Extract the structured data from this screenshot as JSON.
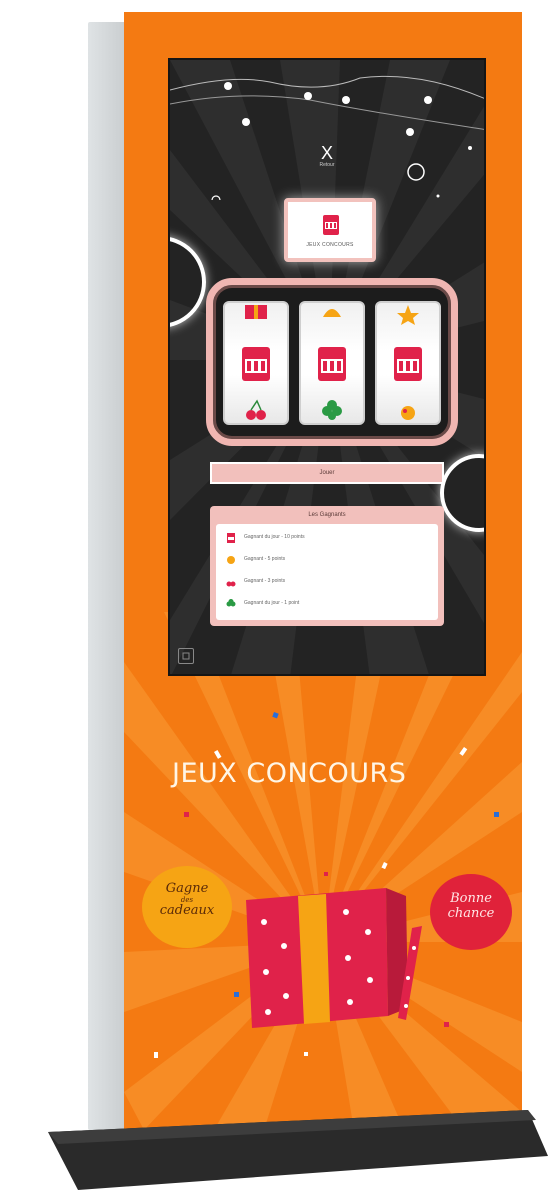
{
  "screen": {
    "close_label": "X",
    "close_caption": "Retour",
    "logo_caption": "JEUX CONCOURS",
    "spin_label": "Jouer",
    "winners_title": "Les Gagnants",
    "winners": [
      {
        "icon": "slot-sign-icon",
        "text": "Gagnant du jour - 10 points"
      },
      {
        "icon": "fruit-icon",
        "text": "Gagnant - 5 points"
      },
      {
        "icon": "cherry-icon",
        "text": "Gagnant - 3 points"
      },
      {
        "icon": "clover-icon",
        "text": "Gagnant du jour - 1 point"
      }
    ]
  },
  "reels": [
    {
      "top": "gift-symbol",
      "middle": "777-sign",
      "bottom": "cherry-symbol"
    },
    {
      "top": "bell-symbol",
      "middle": "777-sign",
      "bottom": "clover-symbol"
    },
    {
      "top": "star-symbol",
      "middle": "777-sign",
      "bottom": "fruit-symbol"
    }
  ],
  "poster": {
    "headline": "JEUX CONCOURS",
    "left_bubble": {
      "line1": "Gagne",
      "small": "des",
      "line2": "cadeaux"
    },
    "right_bubble": {
      "line1": "Bonne",
      "line2": "chance"
    }
  },
  "colors": {
    "front": "#f47a12",
    "ray_light": "#f8922c",
    "screen_bg": "#232323",
    "pink": "#f2c0bc",
    "gift_red": "#e0224a",
    "gift_ribbon": "#f6a414"
  }
}
